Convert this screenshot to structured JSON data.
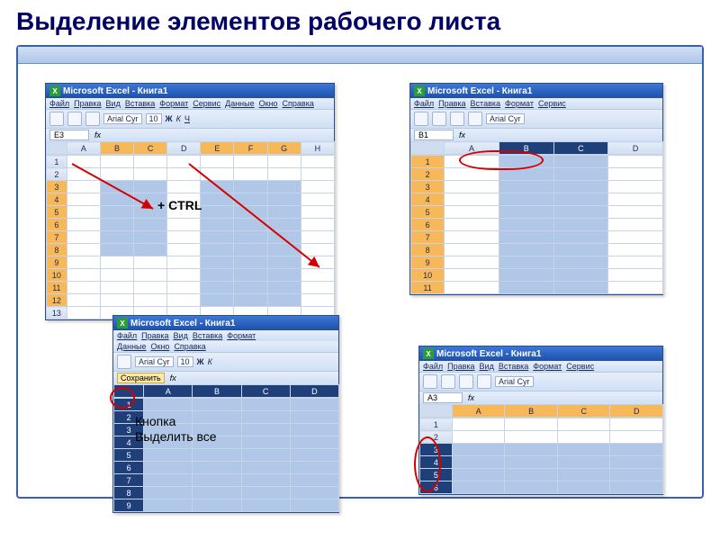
{
  "slide_title": "Выделение элементов рабочего листа",
  "excel_title": "Microsoft Excel - Книга1",
  "menus": {
    "file": "Файл",
    "edit": "Правка",
    "view": "Вид",
    "insert": "Вставка",
    "format": "Формат",
    "tools": "Сервис",
    "data": "Данные",
    "window": "Окно",
    "help": "Справка"
  },
  "font_name": "Arial Cyr",
  "font_size": "10",
  "bold_label": "Ж",
  "italic_label": "К",
  "underline_label": "Ч",
  "fx_symbol": "fx",
  "cells": {
    "w1_namebox": "E3",
    "w2_namebox": "B1",
    "w4_namebox": "A3"
  },
  "col_labels": [
    "A",
    "B",
    "C",
    "D",
    "E",
    "F",
    "G",
    "H"
  ],
  "col_labels_short": [
    "A",
    "B",
    "C",
    "D"
  ],
  "row_labels_12": [
    "1",
    "2",
    "3",
    "4",
    "5",
    "6",
    "7",
    "8",
    "9",
    "10",
    "11",
    "12",
    "13"
  ],
  "row_labels_10": [
    "1",
    "2",
    "3",
    "4",
    "5",
    "6",
    "7",
    "8",
    "9",
    "10",
    "11"
  ],
  "row_labels_9": [
    "1",
    "2",
    "3",
    "4",
    "5",
    "6",
    "7",
    "8",
    "9"
  ],
  "row_labels_6": [
    "1",
    "2",
    "3",
    "4",
    "5",
    "6"
  ],
  "ctrl_label": "+ CTRL",
  "select_all_label": "Кнопка\nВыделить все",
  "tooltip_save": "Сохранить"
}
